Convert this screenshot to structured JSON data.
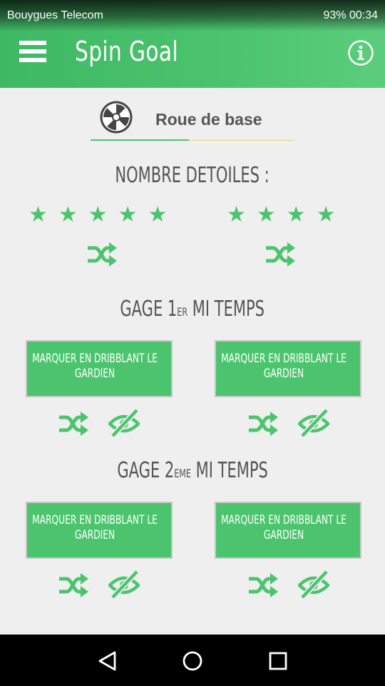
{
  "status_bar": {
    "carrier": "Bouygues Telecom",
    "battery": "93%",
    "time": "00:34"
  },
  "app_bar": {
    "title": "Spin Goal",
    "menu_icon": "hamburger-menu-icon",
    "info_icon": "info-icon"
  },
  "wheel_tab": {
    "label": "Roue de base",
    "icon": "wheel-icon"
  },
  "stars_section": {
    "title": "NOMBRE DETOILES :",
    "left_stars": "★★★★★",
    "right_stars": "★★★★"
  },
  "half1": {
    "title_pre": "GAGE 1",
    "title_sup": "ER",
    "title_post": " MI TEMPS"
  },
  "half2": {
    "title_pre": "GAGE 2",
    "title_sup": "EME",
    "title_post": " MI TEMPS"
  },
  "gages": {
    "h1_left": "MARQUER EN DRIBBLANT LE GARDIEN",
    "h1_right": "MARQUER EN DRIBBLANT LE GARDIEN",
    "h2_left": "MARQUER EN DRIBBLANT LE GARDIEN",
    "h2_right": "MARQUER EN DRIBBLANT LE GARDIEN"
  },
  "colors": {
    "accent": "#4cc46e",
    "background": "#efefef",
    "text": "#555555",
    "navbar": "#000000"
  }
}
